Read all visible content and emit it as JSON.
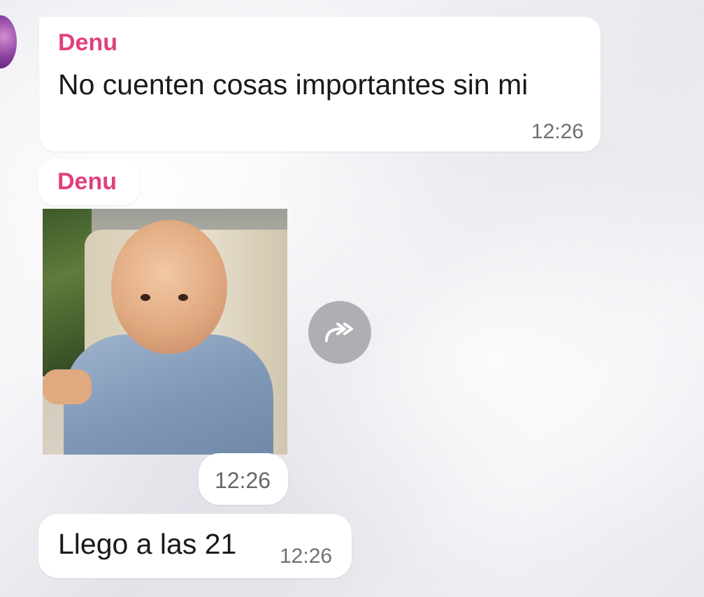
{
  "messages": [
    {
      "sender": "Denu",
      "text": "No cuenten cosas importantes sin mi",
      "time": "12:26"
    },
    {
      "sender": "Denu",
      "type": "photo",
      "time": "12:26"
    },
    {
      "text": "Llego a las 21",
      "time": "12:26"
    }
  ],
  "icons": {
    "avatar": "avatar",
    "forward": "forward-icon"
  },
  "colors": {
    "sender": "#e0407f",
    "bubble": "#ffffff",
    "time": "#6f6f75"
  }
}
